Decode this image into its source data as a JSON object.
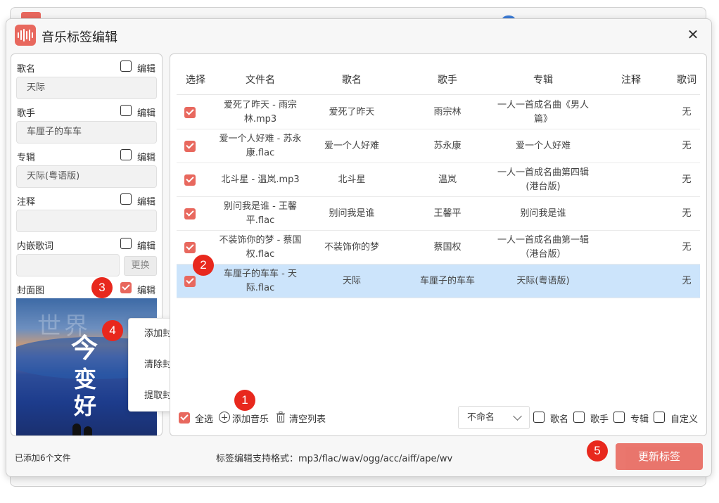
{
  "window": {
    "title": "音乐标签编辑"
  },
  "left_panel": {
    "fields": [
      {
        "label": "歌名",
        "edit_label": "编辑",
        "value": "天际",
        "checked": false
      },
      {
        "label": "歌手",
        "edit_label": "编辑",
        "value": "车厘子的车车",
        "checked": false
      },
      {
        "label": "专辑",
        "edit_label": "编辑",
        "value": "天际(粤语版)",
        "checked": false
      },
      {
        "label": "注释",
        "edit_label": "编辑",
        "value": "",
        "checked": false
      },
      {
        "label": "内嵌歌词",
        "edit_label": "编辑",
        "value": "",
        "checked": false
      }
    ],
    "replace_label": "更换",
    "cover": {
      "label": "封面图",
      "edit_label": "编辑",
      "checked": true
    }
  },
  "context_menu": {
    "items": [
      "添加封面",
      "清除封面",
      "提取封面"
    ]
  },
  "table": {
    "columns": [
      "选择",
      "文件名",
      "歌名",
      "歌手",
      "专辑",
      "注释",
      "歌词"
    ],
    "rows": [
      {
        "checked": true,
        "file": "爱死了昨天 - 雨宗林.mp3",
        "title": "爱死了昨天",
        "artist": "雨宗林",
        "album": "一人一首成名曲《男人篇》",
        "comment": "",
        "lyrics": "无",
        "selected": false
      },
      {
        "checked": true,
        "file": "爱一个人好难 - 苏永康.flac",
        "title": "爱一个人好难",
        "artist": "苏永康",
        "album": "爱一个人好难",
        "comment": "",
        "lyrics": "无",
        "selected": false
      },
      {
        "checked": true,
        "file": "北斗星 - 温岚.mp3",
        "title": "北斗星",
        "artist": "温岚",
        "album": "一人一首成名曲第四辑(港台版)",
        "comment": "",
        "lyrics": "无",
        "selected": false
      },
      {
        "checked": true,
        "file": "别问我是谁 - 王馨平.flac",
        "title": "别问我是谁",
        "artist": "王馨平",
        "album": "别问我是谁",
        "comment": "",
        "lyrics": "无",
        "selected": false
      },
      {
        "checked": true,
        "file": "不装饰你的梦 - 蔡国权.flac",
        "title": "不装饰你的梦",
        "artist": "蔡国权",
        "album": "一人一首成名曲第一辑（港台版）",
        "comment": "",
        "lyrics": "无",
        "selected": false
      },
      {
        "checked": true,
        "file": "车厘子的车车 - 天际.flac",
        "title": "天际",
        "artist": "车厘子的车车",
        "album": "天际(粤语版)",
        "comment": "",
        "lyrics": "无",
        "selected": true
      }
    ]
  },
  "toolbar": {
    "select_all": "全选",
    "add_music": "添加音乐",
    "clear_list": "清空列表",
    "naming_select": "不命名",
    "options": [
      "歌名",
      "歌手",
      "专辑",
      "自定义"
    ]
  },
  "status": {
    "added_files": "已添加6个文件",
    "supported_formats": "标签编辑支持格式：mp3/flac/wav/ogg/acc/aiff/ape/wv"
  },
  "update_button": "更新标签",
  "badges": [
    "1",
    "2",
    "3",
    "4",
    "5"
  ],
  "colors": {
    "accent": "#e8685e",
    "selected_row": "#cce4fb",
    "badge": "#e8281d"
  },
  "cover_art_text": [
    "世界",
    "今",
    "变",
    "好"
  ]
}
